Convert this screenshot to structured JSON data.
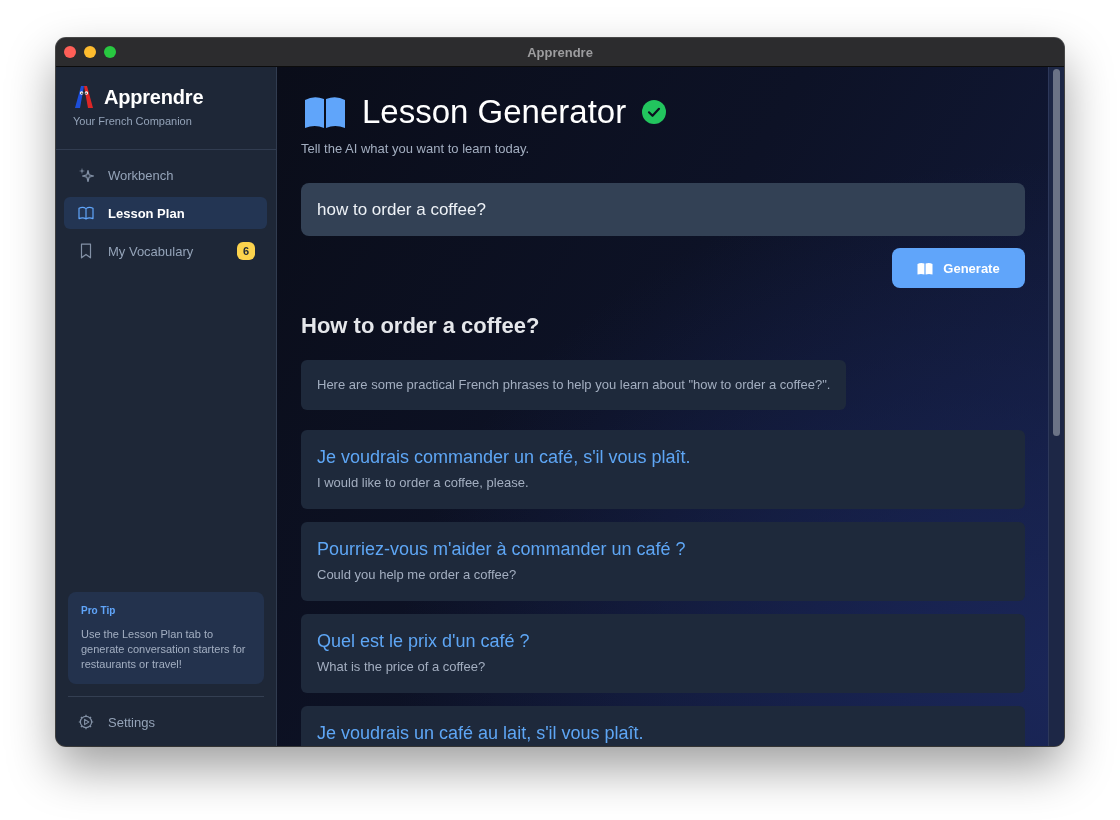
{
  "window": {
    "title": "Apprendre"
  },
  "sidebar": {
    "app_name": "Apprendre",
    "tagline": "Your French Companion",
    "items": [
      {
        "label": "Workbench",
        "selected": false
      },
      {
        "label": "Lesson Plan",
        "selected": true
      },
      {
        "label": "My Vocabulary",
        "selected": false,
        "badge": "6"
      }
    ],
    "tip": {
      "title": "Pro Tip",
      "text": "Use the Lesson Plan tab to generate conversation starters for restaurants or travel!"
    },
    "footer_item": {
      "label": "Settings"
    }
  },
  "main": {
    "title": "Lesson Generator",
    "verified": true,
    "subtitle": "Tell the AI what you want to learn today.",
    "prompt": {
      "value": "how to order a coffee?"
    },
    "generate_button": "Generate",
    "lesson": {
      "heading": "How to order a coffee?",
      "intro": "Here are some practical French phrases to help you learn about \"how to order a coffee?\".",
      "phrases": [
        {
          "french": "Je voudrais commander un café, s'il vous plaît.",
          "english": "I would like to order a coffee, please."
        },
        {
          "french": "Pourriez-vous m'aider à commander un café ?",
          "english": "Could you help me order a coffee?"
        },
        {
          "french": "Quel est le prix d'un café ?",
          "english": "What is the price of a coffee?"
        },
        {
          "french": "Je voudrais un café au lait, s'il vous plaît."
        }
      ]
    }
  }
}
